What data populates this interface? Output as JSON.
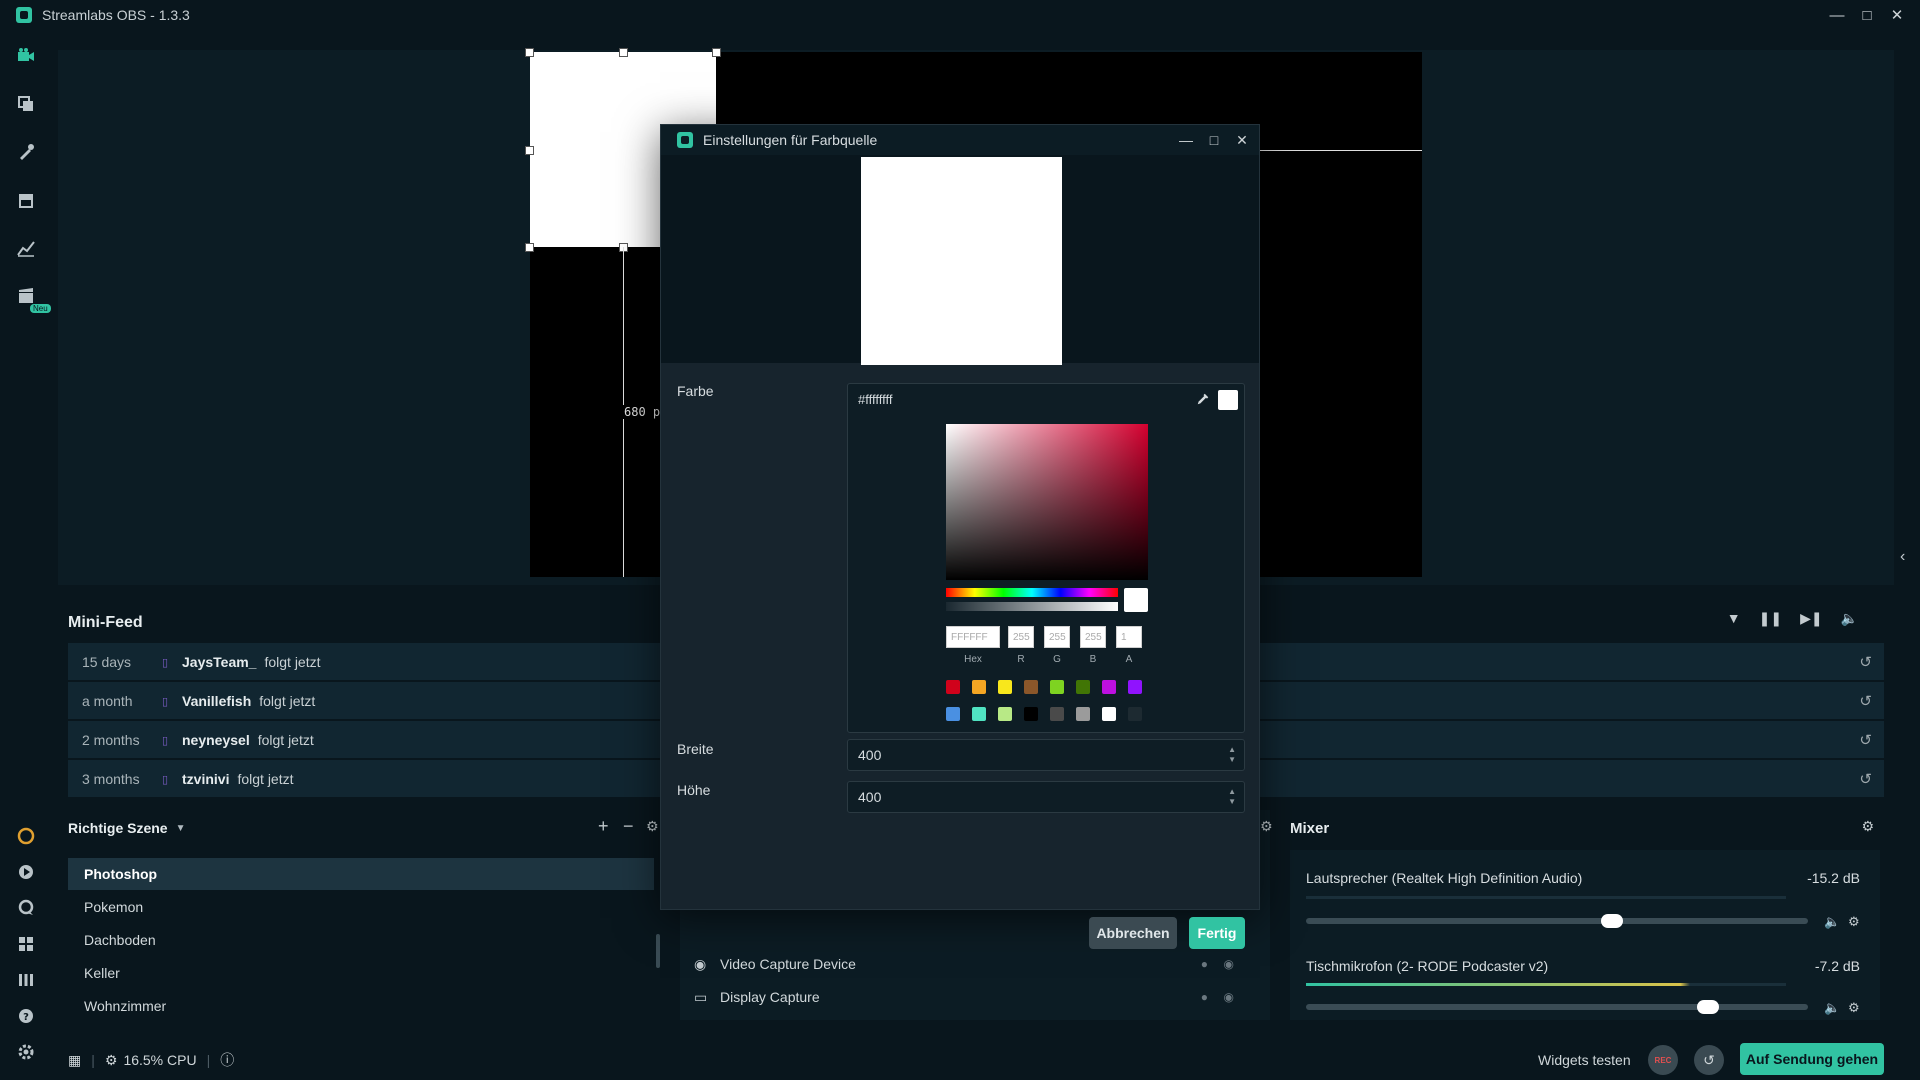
{
  "window": {
    "title": "Streamlabs OBS - 1.3.3"
  },
  "nav": {
    "badge": "Neu"
  },
  "editor": {
    "guide_label": "680 p"
  },
  "dialog": {
    "title": "Einstellungen für Farbquelle",
    "farbe_label": "Farbe",
    "hex_value": "#ffffffff",
    "picker": {
      "hex_field": "FFFFFF",
      "r_field": "255",
      "g_field": "255",
      "b_field": "255",
      "a_field": "1",
      "hex_label": "Hex",
      "r_label": "R",
      "g_label": "G",
      "b_label": "B",
      "a_label": "A",
      "presets_row1": [
        "#d0021b",
        "#f5a623",
        "#f8e71c",
        "#8b572a",
        "#7ed321",
        "#417505",
        "#bd10e0",
        "#9013fe"
      ],
      "presets_row2": [
        "#4a90e2",
        "#50e3c2",
        "#b8e986",
        "#000000",
        "#4a4a4a",
        "#9b9b9b",
        "#ffffff",
        "#1d2a31"
      ]
    },
    "width_label": "Breite",
    "width_value": "400",
    "height_label": "Höhe",
    "height_value": "400",
    "cancel_label": "Abbrechen",
    "done_label": "Fertig"
  },
  "minifeed": {
    "title": "Mini-Feed",
    "items": [
      {
        "when": "15 days",
        "who": "JaysTeam_",
        "what": "folgt jetzt"
      },
      {
        "when": "a month",
        "who": "Vanillefish",
        "what": "folgt jetzt"
      },
      {
        "when": "2 months",
        "who": "neyneysel",
        "what": "folgt jetzt"
      },
      {
        "when": "3 months",
        "who": "tzvinivi",
        "what": "folgt jetzt"
      }
    ]
  },
  "scenes": {
    "title": "Richtige Szene",
    "items": [
      "Photoshop",
      "Pokemon",
      "Dachboden",
      "Keller",
      "Wohnzimmer"
    ]
  },
  "sources": {
    "items": [
      "Video Capture Device",
      "Display Capture"
    ]
  },
  "mixer": {
    "title": "Mixer",
    "channels": [
      {
        "name": "Lautsprecher (Realtek High Definition Audio)",
        "db": "-15.2 dB",
        "volume": 0.61
      },
      {
        "name": "Tischmikrofon (2- RODE Podcaster v2)",
        "db": "-7.2 dB",
        "volume": 0.8
      }
    ]
  },
  "status": {
    "cpu": "16.5% CPU",
    "widgets_test": "Widgets testen",
    "rec": "REC",
    "go_live": "Auf Sendung gehen"
  },
  "colors": {
    "accent": "#31c3a2",
    "bg": "#09161d",
    "panel": "#112631"
  }
}
